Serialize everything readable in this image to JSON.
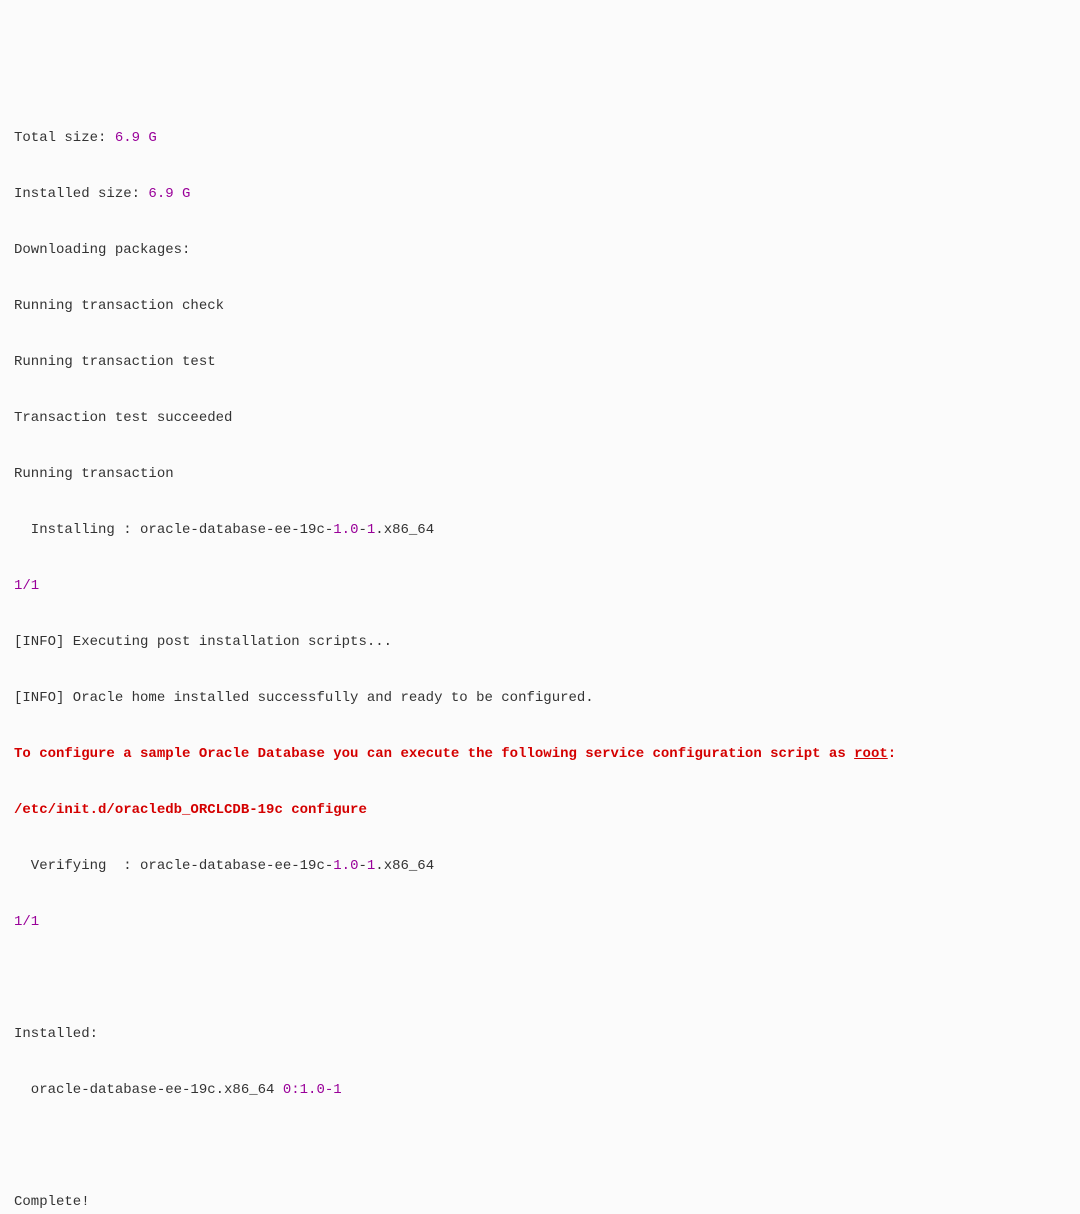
{
  "terminal": {
    "total_size_label": "Total size: ",
    "total_size_value": "6.9 G",
    "installed_size_label": "Installed size: ",
    "installed_size_value": "6.9 G",
    "downloading": "Downloading packages:",
    "run_check": "Running transaction check",
    "run_test": "Running transaction test",
    "test_succeeded": "Transaction test succeeded",
    "run_transaction": "Running transaction",
    "installing_prefix": "  Installing : oracle-database-ee-19c-",
    "installing_version1": "1.0",
    "installing_dash": "-",
    "installing_version2": "1",
    "installing_suffix": ".x86_64",
    "progress_1": "1/1",
    "info_post": "[INFO] Executing post installation scripts...",
    "info_home": "[INFO] Oracle home installed successfully and ready to be configured.",
    "redline1_pre": "To configure a sample Oracle Database you can execute the following service configuration script as ",
    "redline1_root": "root",
    "redline1_colon": ":",
    "redline2": "/etc/init.d/oracledb_ORCLCDB-19c configure",
    "verifying_prefix": "  Verifying  : oracle-database-ee-19c-",
    "verifying_version1": "1.0",
    "verifying_dash": "-",
    "verifying_version2": "1",
    "verifying_suffix": ".x86_64",
    "progress_2": "1/1",
    "blank1": " ",
    "installed_header": "Installed:",
    "installed_pkg_prefix": "  oracle-database-ee-19c.x86_64 ",
    "installed_pkg_ver": "0:1.0-1",
    "blank2": " ",
    "complete": "Complete!"
  }
}
